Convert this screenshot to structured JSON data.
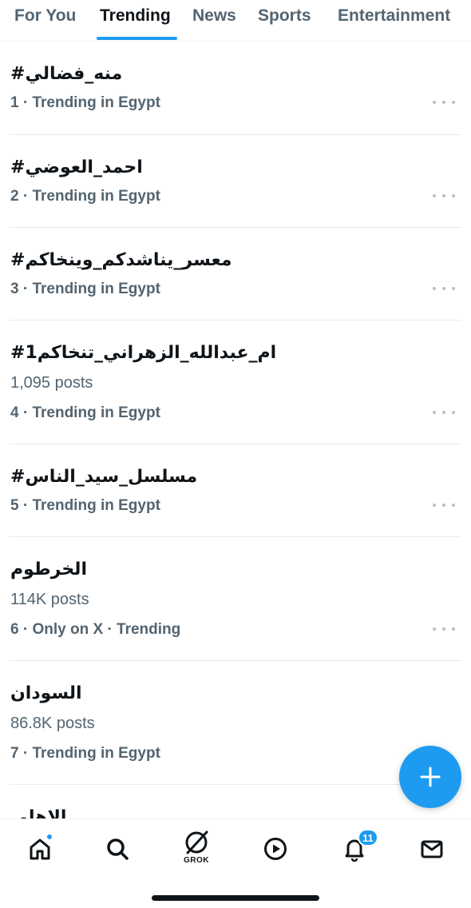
{
  "tabs": [
    {
      "label": "For You",
      "active": false
    },
    {
      "label": "Trending",
      "active": true
    },
    {
      "label": "News",
      "active": false
    },
    {
      "label": "Sports",
      "active": false
    },
    {
      "label": "Entertainment",
      "active": false
    }
  ],
  "trends": [
    {
      "name": "#منه_فضالي",
      "posts": "",
      "meta": "1 · Trending in Egypt"
    },
    {
      "name": "#احمد_العوضي",
      "posts": "",
      "meta": "2 · Trending in Egypt"
    },
    {
      "name": "#معسر_يناشدكم_وينخاكم",
      "posts": "",
      "meta": "3 · Trending in Egypt"
    },
    {
      "name": "#ام_عبدالله_الزهراني_تنخاكم1",
      "posts": "1,095 posts",
      "meta": "4 · Trending in Egypt"
    },
    {
      "name": "#مسلسل_سيد_الناس",
      "posts": "",
      "meta": "5 · Trending in Egypt"
    },
    {
      "name": "الخرطوم",
      "posts": "114K posts",
      "meta": "6 · Only on X · Trending"
    },
    {
      "name": "السودان",
      "posts": "86.8K posts",
      "meta": "7 · Trending in Egypt"
    },
    {
      "name": "الاهلي",
      "posts": "",
      "meta": ""
    }
  ],
  "nav": {
    "items": [
      "home-icon",
      "search-icon",
      "grok-icon",
      "play-icon",
      "bell-icon",
      "mail-icon"
    ],
    "grok_label": "GROK",
    "notifications_badge": "11"
  },
  "colors": {
    "accent": "#1d9bf0",
    "text_primary": "#0f1419",
    "text_secondary": "#536471"
  }
}
